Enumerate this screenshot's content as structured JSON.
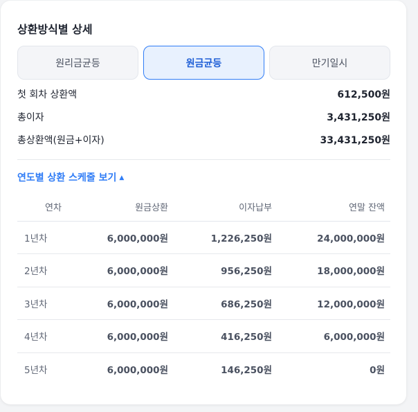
{
  "title": "상환방식별 상세",
  "tabs": [
    {
      "label": "원리금균등",
      "active": false
    },
    {
      "label": "원금균등",
      "active": true
    },
    {
      "label": "만기일시",
      "active": false
    }
  ],
  "summary": {
    "first_payment": {
      "label": "첫 회차 상환액",
      "value": "612,500원"
    },
    "total_interest": {
      "label": "총이자",
      "value": "3,431,250원"
    },
    "total_repayment": {
      "label": "총상환액(원금+이자)",
      "value": "33,431,250원"
    }
  },
  "schedule_toggle": {
    "label": "연도별 상환 스케줄 보기",
    "caret": "▲"
  },
  "table": {
    "headers": [
      "연차",
      "원금상환",
      "이자납부",
      "연말 잔액"
    ],
    "rows": [
      [
        "1년차",
        "6,000,000원",
        "1,226,250원",
        "24,000,000원"
      ],
      [
        "2년차",
        "6,000,000원",
        "956,250원",
        "18,000,000원"
      ],
      [
        "3년차",
        "6,000,000원",
        "686,250원",
        "12,000,000원"
      ],
      [
        "4년차",
        "6,000,000원",
        "416,250원",
        "6,000,000원"
      ],
      [
        "5년차",
        "6,000,000원",
        "146,250원",
        "0원"
      ]
    ]
  },
  "colors": {
    "accent": "#2f7cf6",
    "active_tab_bg": "#e8f1fe"
  }
}
